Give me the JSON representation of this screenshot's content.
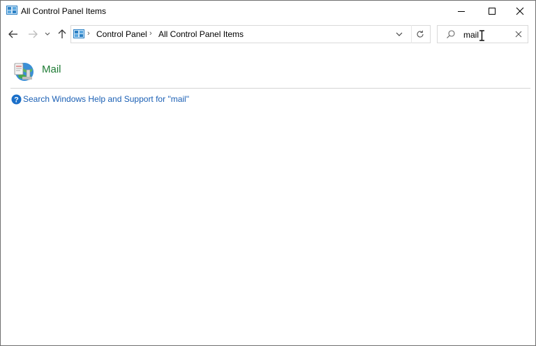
{
  "window": {
    "title": "All Control Panel Items",
    "controls": {
      "minimize": "minimize",
      "maximize": "maximize",
      "close": "close"
    }
  },
  "navigation": {
    "back_icon": "arrow-left-icon",
    "forward_icon": "arrow-right-icon",
    "recent_icon": "chevron-down-icon",
    "up_icon": "arrow-up-icon"
  },
  "address": {
    "breadcrumbs": [
      "Control Panel",
      "All Control Panel Items"
    ],
    "separator": "›"
  },
  "search": {
    "value": "mail"
  },
  "results": {
    "items": [
      {
        "label": "Mail",
        "icon": "mail-globe-icon"
      }
    ],
    "help_link": "Search Windows Help and Support for \"mail\""
  },
  "colors": {
    "result_title": "#1e7b34",
    "link": "#1a5fb4",
    "help_icon": "#1a6fc9"
  }
}
